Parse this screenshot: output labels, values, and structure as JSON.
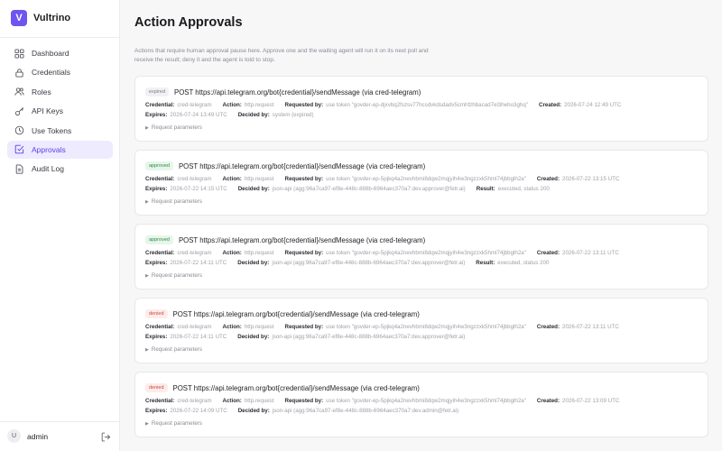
{
  "app": {
    "logo_letter": "V",
    "name": "Vultrino"
  },
  "sidebar": {
    "items": [
      {
        "label": "Dashboard",
        "icon": "grid-icon",
        "active": false
      },
      {
        "label": "Credentials",
        "icon": "lock-icon",
        "active": false
      },
      {
        "label": "Roles",
        "icon": "users-icon",
        "active": false
      },
      {
        "label": "API Keys",
        "icon": "key-icon",
        "active": false
      },
      {
        "label": "Use Tokens",
        "icon": "clock-icon",
        "active": false
      },
      {
        "label": "Approvals",
        "icon": "check-square-icon",
        "active": true
      },
      {
        "label": "Audit Log",
        "icon": "document-icon",
        "active": false
      }
    ]
  },
  "user": {
    "initial": "U",
    "name": "admin"
  },
  "page": {
    "title": "Action Approvals",
    "intro": "Actions that require human approval pause here. Approve one and the waiting agent will run it on its next poll and receive the result; deny it and the agent is told to stop."
  },
  "labels": {
    "credential": "Credential:",
    "action": "Action:",
    "requested_by": "Requested by:",
    "created": "Created:",
    "expires": "Expires:",
    "decided_by": "Decided by:",
    "result": "Result:",
    "request_parameters": "Request parameters"
  },
  "approvals": [
    {
      "status": "expired",
      "title": "POST https://api.telegram.org/bot{credential}/sendMessage (via cred-telegram)",
      "credential": "cred-telegram",
      "action": "http.request",
      "requested_by": "use token \"govder-ep-djxvbq2fszsv77hcsdvkdsdadv5cmhfzhbacad7el3heho3ghq\"",
      "created": "2026-07-24 12:49 UTC",
      "expires": "2026-07-24 13:49 UTC",
      "decided_by": "system (expired)",
      "result": ""
    },
    {
      "status": "approved",
      "title": "POST https://api.telegram.org/bot{credential}/sendMessage (via cred-telegram)",
      "credential": "cred-telegram",
      "action": "http.request",
      "requested_by": "use token \"govder-ep-5pjkq4a2nevhbmi8dqw2mqjyih4w3ngzzxk5hml74jbbglh2a\"",
      "created": "2026-07-22 13:15 UTC",
      "expires": "2026-07-22 14:15 UTC",
      "decided_by": "json-api (agg:96a7ca97-ef8e-448c-888b-6964aec370a7:dev.approver@fetr.ai)",
      "result": "executed, status 200"
    },
    {
      "status": "approved",
      "title": "POST https://api.telegram.org/bot{credential}/sendMessage (via cred-telegram)",
      "credential": "cred-telegram",
      "action": "http.request",
      "requested_by": "use token \"govder-ep-5pjkq4a2nevhbmi8dqw2mqjyih4w3ngzzxk5hml74jbbglh2a\"",
      "created": "2026-07-22 13:11 UTC",
      "expires": "2026-07-22 14:11 UTC",
      "decided_by": "json-api (agg:96a7ca97-ef8e-448c-888b-6964aec370a7:dev.approver@fetr.ai)",
      "result": "executed, status 200"
    },
    {
      "status": "denied",
      "title": "POST https://api.telegram.org/bot{credential}/sendMessage (via cred-telegram)",
      "credential": "cred-telegram",
      "action": "http.request",
      "requested_by": "use token \"govder-ep-5pjkq4a2nevhbmi8dqw2mqjyih4w3ngzzxk5hml74jbbglh2a\"",
      "created": "2026-07-22 13:11 UTC",
      "expires": "2026-07-22 14:11 UTC",
      "decided_by": "json-api (agg:96a7ca97-ef8e-448c-888b-6964aec370a7:dev.approver@fetr.ai)",
      "result": ""
    },
    {
      "status": "denied",
      "title": "POST https://api.telegram.org/bot{credential}/sendMessage (via cred-telegram)",
      "credential": "cred-telegram",
      "action": "http.request",
      "requested_by": "use token \"govder-ep-5pjkq4a2nevhbmi8dqw2mqjyih4w3ngzzxk5hml74jbbglh2a\"",
      "created": "2026-07-22 13:09 UTC",
      "expires": "2026-07-22 14:09 UTC",
      "decided_by": "json-api (agg:96a7ca97-ef8e-448c-888b-6964aec370a7:dev.admin@fetr.ai)",
      "result": ""
    }
  ]
}
